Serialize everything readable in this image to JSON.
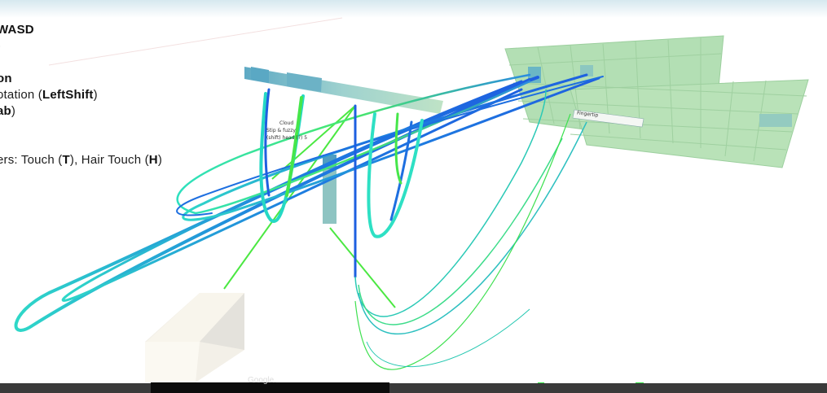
{
  "hud": {
    "move": "WASD",
    "paren": ")",
    "mode": "on",
    "rotation_prefix": "otation (",
    "rotation_key": "LeftShift",
    "rotation_suffix": ")",
    "tab_key": "ab",
    "tab_suffix": ")",
    "triggers_prefix": "ers: Touch (",
    "triggers_key1": "T",
    "triggers_mid": "), Hair Touch (",
    "triggers_key2": "H",
    "triggers_suffix": ")"
  },
  "scene_labels": {
    "center_label_1": "Cloud",
    "center_label_2": "Stip & fuzzy",
    "center_label_3": "(shift) head (?) 5",
    "panel_label": "Fingertip",
    "bottom_caption": "Google."
  },
  "colors": {
    "sky": "#e3eef3",
    "panel": "#a9d9ad",
    "cube": "#f6f3ea",
    "bar": "#8cc7c7",
    "stroke_blue": "#1e6fe0",
    "stroke_green": "#3ee83e",
    "stroke_cyan": "#27d6c8",
    "taskbar": "#3a3a3a"
  }
}
